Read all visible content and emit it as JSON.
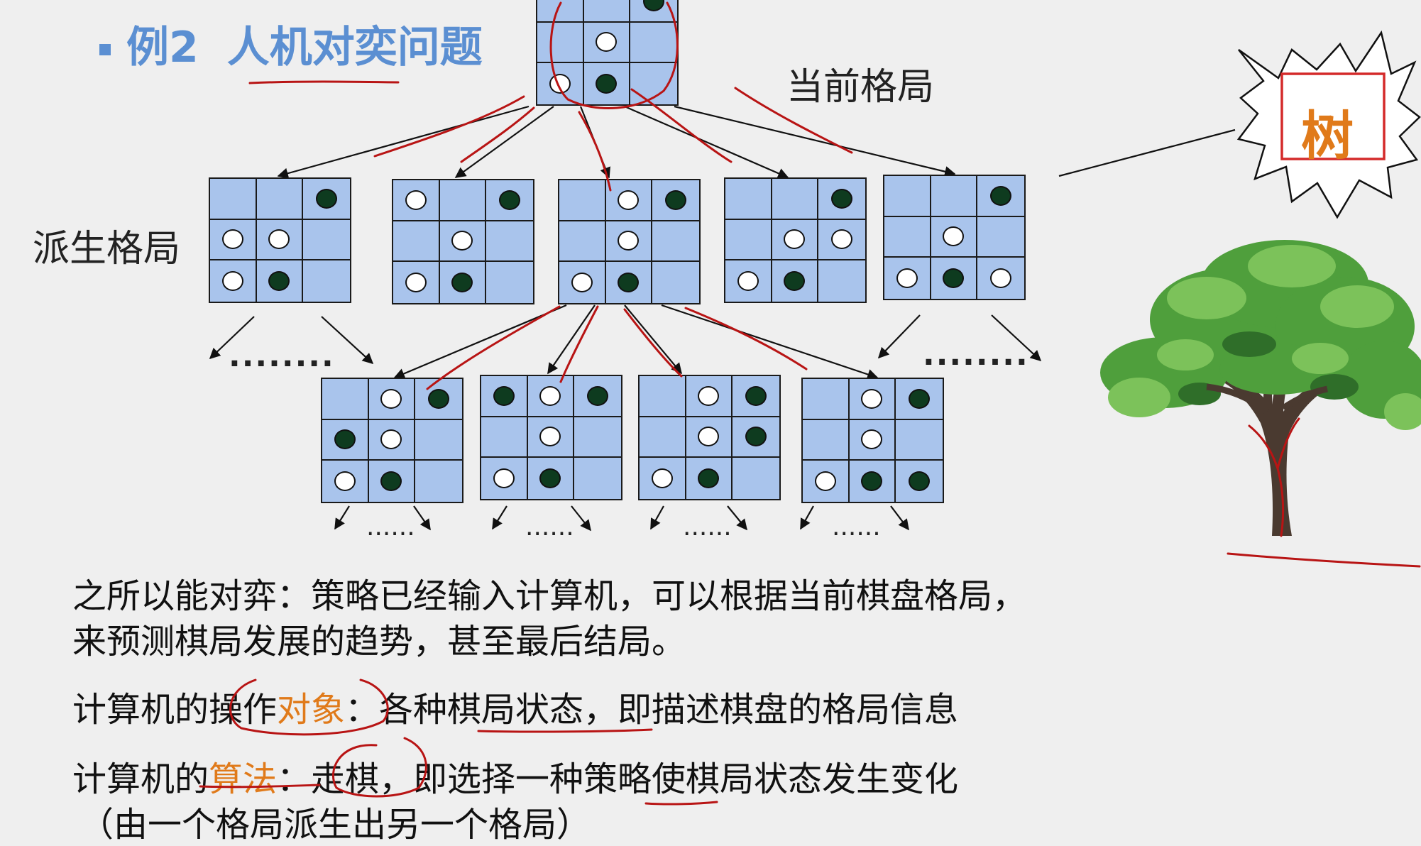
{
  "title": {
    "prefix": "例2",
    "text": "人机对奕问题"
  },
  "labels": {
    "current": "当前格局",
    "derived": "派生格局",
    "tree": "树"
  },
  "boards": {
    "root": [
      "e",
      "e",
      "b",
      "e",
      "w",
      "e",
      "w",
      "b",
      "e"
    ],
    "level1": [
      [
        "e",
        "e",
        "b",
        "w",
        "w",
        "e",
        "w",
        "b",
        "e"
      ],
      [
        "w",
        "e",
        "b",
        "e",
        "w",
        "e",
        "w",
        "b",
        "e"
      ],
      [
        "e",
        "w",
        "b",
        "e",
        "w",
        "e",
        "w",
        "b",
        "e"
      ],
      [
        "e",
        "e",
        "b",
        "e",
        "w",
        "w",
        "w",
        "b",
        "e"
      ],
      [
        "e",
        "e",
        "b",
        "e",
        "w",
        "e",
        "w",
        "b",
        "w"
      ]
    ],
    "level2": [
      [
        "e",
        "w",
        "b",
        "b",
        "w",
        "e",
        "w",
        "b",
        "e"
      ],
      [
        "b",
        "w",
        "b",
        "e",
        "w",
        "e",
        "w",
        "b",
        "e"
      ],
      [
        "e",
        "w",
        "b",
        "e",
        "w",
        "b",
        "w",
        "b",
        "e"
      ],
      [
        "e",
        "w",
        "b",
        "e",
        "w",
        "e",
        "w",
        "b",
        "b"
      ]
    ]
  },
  "ellipsis": {
    "level1": "........",
    "level2": "......"
  },
  "paragraphs": {
    "p1_line1": "之所以能对弈：策略已经输入计算机，可以根据当前棋盘格局，",
    "p1_line2": "来预测棋局发展的趋势，甚至最后结局。",
    "p2_a": "计算机的操作",
    "p2_b": "对象",
    "p2_c": "：各种棋局状态，即描述棋盘的格局信息",
    "p3_a": "计算机的",
    "p3_b": "算法",
    "p3_c": "：走棋，即选择一种策略使棋局状态发生变化",
    "p3_line2": "（由一个格局派生出另一个格局）"
  },
  "colors": {
    "title": "#5b8fd2",
    "board_fill": "#a9c4ec",
    "black_piece": "#0e3b1f",
    "white_piece": "#ffffff",
    "highlight": "#e07a1a",
    "annotation": "#b81414",
    "tree_box": "#d42a2a"
  }
}
